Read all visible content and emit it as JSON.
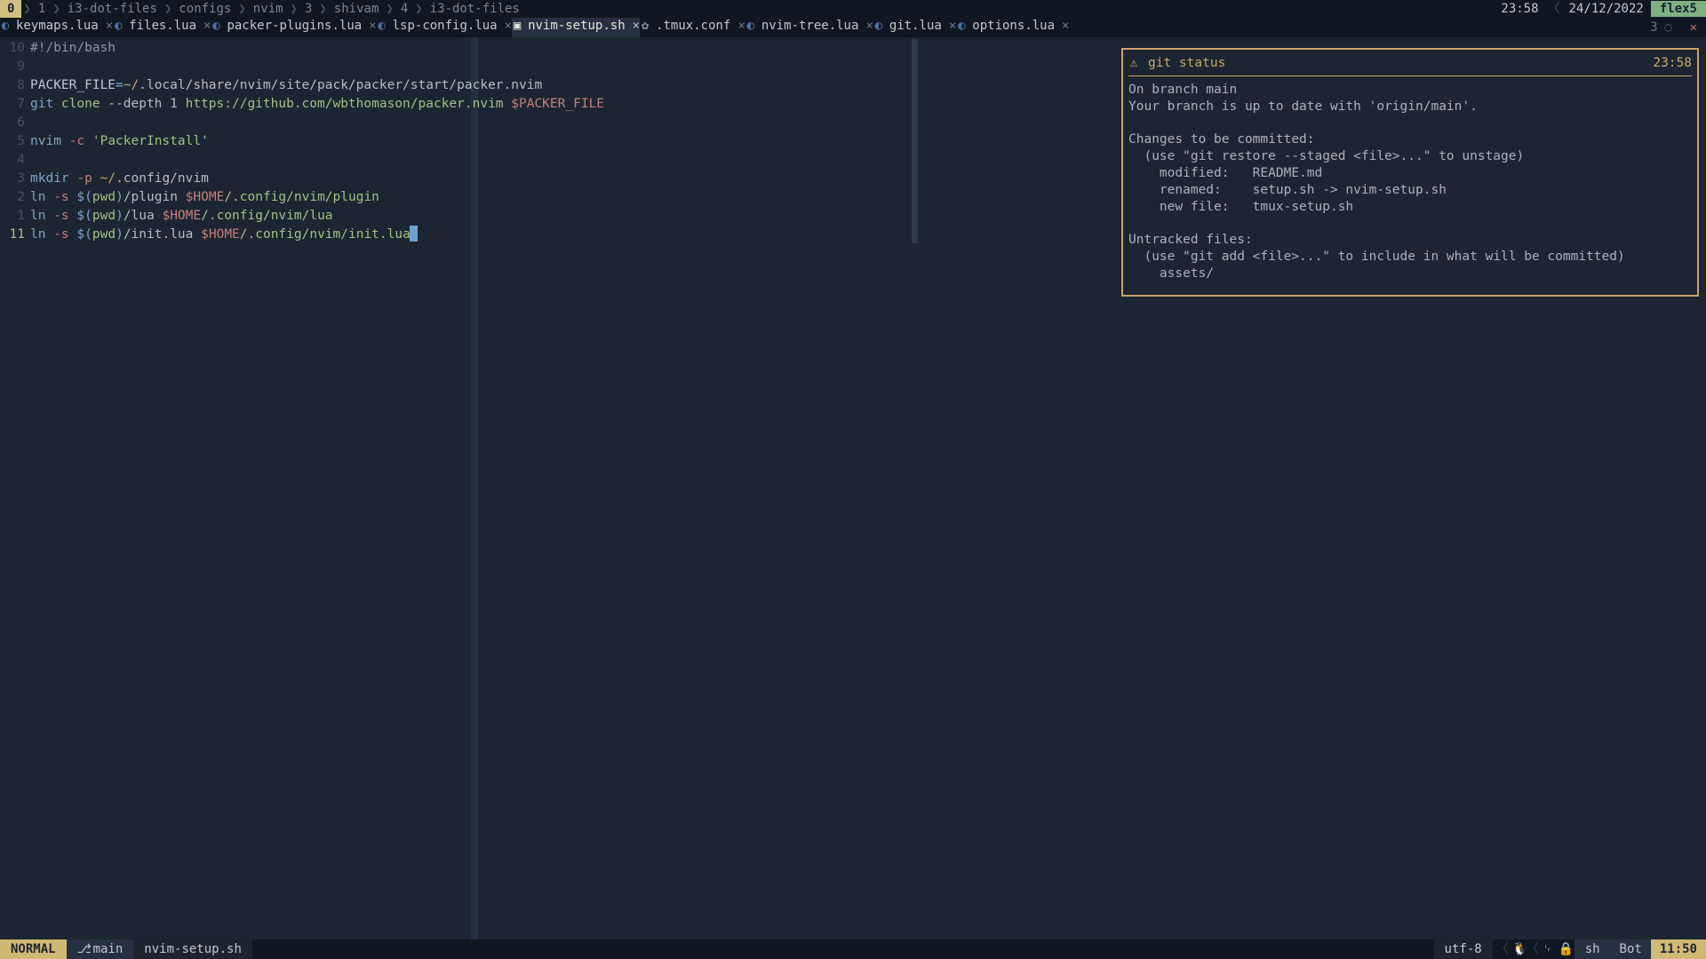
{
  "topbar": {
    "session_idx": "0",
    "crumbs": [
      "1",
      "i3-dot-files",
      "configs",
      "nvim",
      "3",
      "shivam",
      "4",
      "i3-dot-files"
    ],
    "clock_time": "23:58",
    "clock_date": "24/12/2022",
    "wm_label": "flex5"
  },
  "tabs": [
    {
      "label": "keymaps.lua",
      "icon": "lua",
      "active": false
    },
    {
      "label": "files.lua",
      "icon": "lua",
      "active": false
    },
    {
      "label": "packer-plugins.lua",
      "icon": "lua",
      "active": false
    },
    {
      "label": "lsp-config.lua",
      "icon": "lua",
      "active": false
    },
    {
      "label": "nvim-setup.sh",
      "icon": "term",
      "active": true
    },
    {
      "label": ".tmux.conf",
      "icon": "gear",
      "active": false
    },
    {
      "label": "nvim-tree.lua",
      "icon": "lua",
      "active": false
    },
    {
      "label": "git.lua",
      "icon": "lua",
      "active": false
    },
    {
      "label": "options.lua",
      "icon": "lua",
      "active": false
    }
  ],
  "tabline_right": {
    "count": "3",
    "glyph": "◌"
  },
  "gutter_numbers": [
    "10",
    "9",
    "8",
    "7",
    "6",
    "5",
    "4",
    "3",
    "2",
    "1",
    "11"
  ],
  "code_lines": [
    [
      [
        "tok-grey",
        "#!/bin/bash"
      ]
    ],
    [],
    [
      [
        "tok-var",
        "PACKER_FILE"
      ],
      [
        "tok-blue",
        "="
      ],
      [
        "tok-orange",
        "~/"
      ],
      [
        "tok-pale",
        ".local/share/nvim/site/pack/packer/start/packer.nvim"
      ]
    ],
    [
      [
        "tok-blue",
        "git "
      ],
      [
        "tok-green",
        "clone"
      ],
      [
        "tok-pale",
        " --depth 1 "
      ],
      [
        "tok-green",
        "https://github.com/wbthomason/packer.nvim "
      ],
      [
        "tok-red",
        "$PACKER_FILE"
      ]
    ],
    [],
    [
      [
        "tok-blue",
        "nvim "
      ],
      [
        "tok-red",
        "-c "
      ],
      [
        "tok-green",
        "'PackerInstall'"
      ]
    ],
    [],
    [
      [
        "tok-blue",
        "mkdir "
      ],
      [
        "tok-red",
        "-p "
      ],
      [
        "tok-orange",
        "~/"
      ],
      [
        "tok-pale",
        ".config/nvim"
      ]
    ],
    [
      [
        "tok-blue",
        "ln "
      ],
      [
        "tok-red",
        "-s "
      ],
      [
        "tok-blue",
        "$("
      ],
      [
        "tok-green",
        "pwd"
      ],
      [
        "tok-blue",
        ")"
      ],
      [
        "tok-pale",
        "/plugin "
      ],
      [
        "tok-red",
        "$HOME"
      ],
      [
        "tok-green",
        "/.config/nvim/plugin"
      ]
    ],
    [
      [
        "tok-blue",
        "ln "
      ],
      [
        "tok-red",
        "-s "
      ],
      [
        "tok-blue",
        "$("
      ],
      [
        "tok-green",
        "pwd"
      ],
      [
        "tok-blue",
        ")"
      ],
      [
        "tok-pale",
        "/lua "
      ],
      [
        "tok-red",
        "$HOME"
      ],
      [
        "tok-green",
        "/.config/nvim/lua"
      ]
    ],
    [
      [
        "tok-blue",
        "ln "
      ],
      [
        "tok-red",
        "-s "
      ],
      [
        "tok-blue",
        "$("
      ],
      [
        "tok-green",
        "pwd"
      ],
      [
        "tok-blue",
        ")"
      ],
      [
        "tok-pale",
        "/init.lua "
      ],
      [
        "tok-red",
        "$HOME"
      ],
      [
        "tok-green",
        "/.config/nvim/init.lua"
      ]
    ]
  ],
  "cursor_at_line_index": 10,
  "float_term": {
    "title": "git status",
    "time": "23:58",
    "body": "On branch main\nYour branch is up to date with 'origin/main'.\n\nChanges to be committed:\n  (use \"git restore --staged <file>...\" to unstage)\n    modified:   README.md\n    renamed:    setup.sh -> nvim-setup.sh\n    new file:   tmux-setup.sh\n\nUntracked files:\n  (use \"git add <file>...\" to include in what will be committed)\n    assets/\n"
  },
  "statusline": {
    "mode": "NORMAL",
    "branch_icon": "⎇",
    "branch": "main",
    "filename": "nvim-setup.sh",
    "encoding": "utf-8",
    "filetype": "sh",
    "percent": "Bot",
    "pos": "11:50",
    "glyph_eol": "␊",
    "glyph_lock": "🔒",
    "glyph_tux": "🐧"
  }
}
